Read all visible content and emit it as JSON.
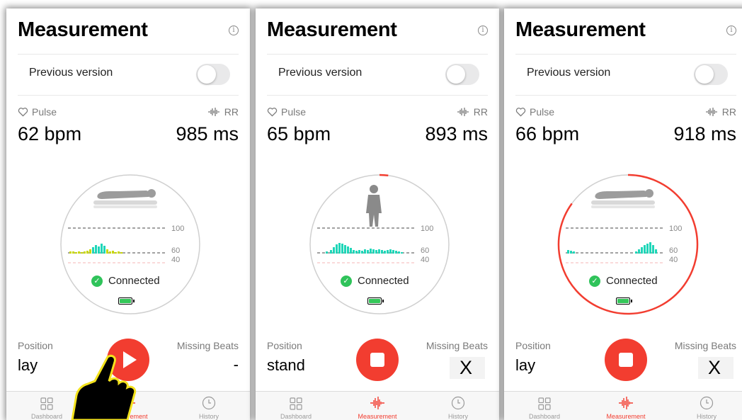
{
  "colors": {
    "accent": "#f23d30",
    "green": "#2fc35a",
    "bar_cyan": "#1fd6b8",
    "bar_yellow": "#c9d800"
  },
  "screens": [
    {
      "title": "Measurement",
      "previous_version_label": "Previous version",
      "previous_version_on": false,
      "pulse_label": "Pulse",
      "rr_label": "RR",
      "pulse_value": "62 bpm",
      "rr_value": "985 ms",
      "dial": {
        "position_icon": "person-lying-icon",
        "scale_labels": [
          "100",
          "60",
          "40"
        ],
        "status": "Connected",
        "progress": 0
      },
      "position_label": "Position",
      "position_value": "lay",
      "missing_beats_label": "Missing Beats",
      "missing_beats_value": "-",
      "action_button": "play",
      "tabs": [
        {
          "label": "Dashboard",
          "icon": "grid-icon",
          "active": false
        },
        {
          "label": "Measurement",
          "icon": "waveform-icon",
          "active": true
        },
        {
          "label": "History",
          "icon": "clock-icon",
          "active": false
        }
      ]
    },
    {
      "title": "Measurement",
      "previous_version_label": "Previous version",
      "previous_version_on": false,
      "pulse_label": "Pulse",
      "rr_label": "RR",
      "pulse_value": "65 bpm",
      "rr_value": "893 ms",
      "dial": {
        "position_icon": "person-standing-icon",
        "scale_labels": [
          "100",
          "60",
          "40"
        ],
        "status": "Connected",
        "progress": 0.02
      },
      "position_label": "Position",
      "position_value": "stand",
      "missing_beats_label": "Missing Beats",
      "missing_beats_value": "X",
      "action_button": "stop",
      "tabs": [
        {
          "label": "Dashboard",
          "icon": "grid-icon",
          "active": false
        },
        {
          "label": "Measurement",
          "icon": "waveform-icon",
          "active": true
        },
        {
          "label": "History",
          "icon": "clock-icon",
          "active": false
        }
      ]
    },
    {
      "title": "Measurement",
      "previous_version_label": "Previous version",
      "previous_version_on": false,
      "pulse_label": "Pulse",
      "rr_label": "RR",
      "pulse_value": "66 bpm",
      "rr_value": "918 ms",
      "dial": {
        "position_icon": "person-lying-icon",
        "scale_labels": [
          "100",
          "60",
          "40"
        ],
        "status": "Connected",
        "progress": 0.85
      },
      "position_label": "Position",
      "position_value": "lay",
      "missing_beats_label": "Missing Beats",
      "missing_beats_value": "X",
      "action_button": "stop",
      "tabs": [
        {
          "label": "Dashboard",
          "icon": "grid-icon",
          "active": false
        },
        {
          "label": "Measurement",
          "icon": "waveform-icon",
          "active": true
        },
        {
          "label": "History",
          "icon": "clock-icon",
          "active": false
        }
      ]
    }
  ]
}
